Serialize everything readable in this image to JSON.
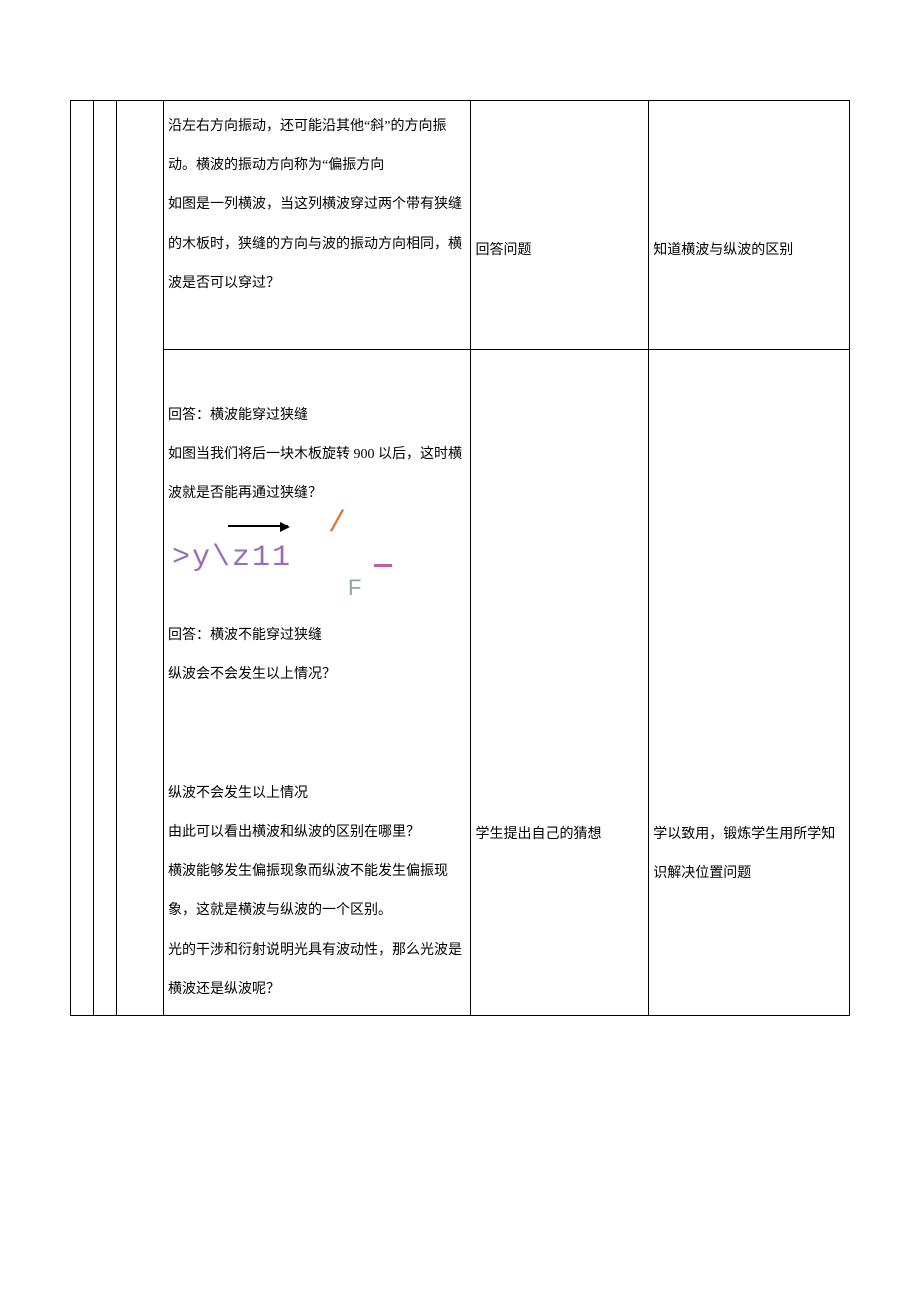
{
  "row1": {
    "col4": {
      "p1": "沿左右方向振动，还可能沿其他“斜”的方向振动。横波的振动方向称为“偏振方向",
      "p2": "如图是一列横波，当这列横波穿过两个带有狭缝的木板时，狭缝的方向与波的振动方向相同，横波是否可以穿过？"
    },
    "col5": "回答问题",
    "col6": "知道横波与纵波的区别"
  },
  "row2": {
    "col4": {
      "p1": "回答：横波能穿过狭缝",
      "p2": "如图当我们将后一块木板旋转 900 以后，这时横波就是否能再通过狭缝？",
      "formula_line2": ">y\\z11",
      "formula_dash": "—",
      "formula_F": "F",
      "p3": "回答：横波不能穿过狭缝",
      "p4": "纵波会不会发生以上情况？",
      "p5": "纵波不会发生以上情况",
      "p6": "由此可以看出横波和纵波的区别在哪里？",
      "p7": "横波能够发生偏振现象而纵波不能发生偏振现象，这就是横波与纵波的一个区别。",
      "p8": "光的干涉和衍射说明光具有波动性，那么光波是横波还是纵波呢？"
    },
    "col5": "学生提出自己的猜想",
    "col6": "学以致用，锻炼学生用所学知识解决位置问题"
  }
}
